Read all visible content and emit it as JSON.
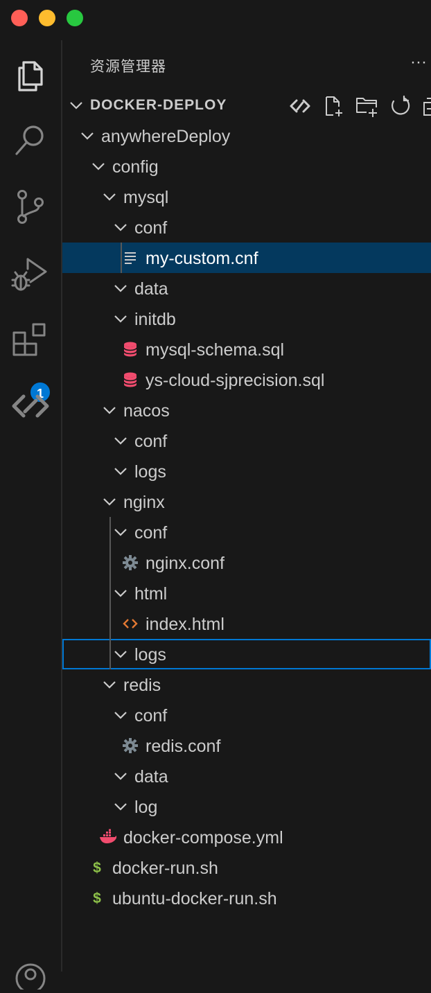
{
  "window": {
    "close_color": "#ff5f57",
    "minimize_color": "#febc2e",
    "maximize_color": "#28c840"
  },
  "activity_bar": {
    "items": [
      {
        "icon": "files-icon"
      },
      {
        "icon": "search-icon"
      },
      {
        "icon": "source-control-icon"
      },
      {
        "icon": "run-debug-icon"
      },
      {
        "icon": "extensions-icon",
        "badge": "1"
      },
      {
        "icon": "remote-icon"
      },
      {
        "icon": "account-icon"
      }
    ]
  },
  "explorer": {
    "title": "资源管理器",
    "more": "···",
    "root": "DOCKER-DEPLOY",
    "toolbar": [
      "remote-icon",
      "new-file-icon",
      "new-folder-icon",
      "refresh-icon",
      "collapse-all-icon"
    ]
  },
  "tree": [
    {
      "label": "anywhereDeploy",
      "type": "folder",
      "depth": 1
    },
    {
      "label": "config",
      "type": "folder",
      "depth": 2
    },
    {
      "label": "mysql",
      "type": "folder",
      "depth": 3
    },
    {
      "label": "conf",
      "type": "folder",
      "depth": 4
    },
    {
      "label": "my-custom.cnf",
      "type": "file",
      "icon": "text-file-icon",
      "depth": 5,
      "selected": true
    },
    {
      "label": "data",
      "type": "folder",
      "depth": 4
    },
    {
      "label": "initdb",
      "type": "folder",
      "depth": 4
    },
    {
      "label": "mysql-schema.sql",
      "type": "file",
      "icon": "database-icon",
      "depth": 5
    },
    {
      "label": "ys-cloud-sjprecision.sql",
      "type": "file",
      "icon": "database-icon",
      "depth": 5
    },
    {
      "label": "nacos",
      "type": "folder",
      "depth": 3
    },
    {
      "label": "conf",
      "type": "folder",
      "depth": 4
    },
    {
      "label": "logs",
      "type": "folder",
      "depth": 4
    },
    {
      "label": "nginx",
      "type": "folder",
      "depth": 3
    },
    {
      "label": "conf",
      "type": "folder",
      "depth": 4
    },
    {
      "label": "nginx.conf",
      "type": "file",
      "icon": "gear-icon",
      "depth": 5
    },
    {
      "label": "html",
      "type": "folder",
      "depth": 4
    },
    {
      "label": "index.html",
      "type": "file",
      "icon": "html-icon",
      "depth": 5
    },
    {
      "label": "logs",
      "type": "folder",
      "depth": 4,
      "focused": true
    },
    {
      "label": "redis",
      "type": "folder",
      "depth": 3
    },
    {
      "label": "conf",
      "type": "folder",
      "depth": 4
    },
    {
      "label": "redis.conf",
      "type": "file",
      "icon": "gear-icon",
      "depth": 5
    },
    {
      "label": "data",
      "type": "folder",
      "depth": 4
    },
    {
      "label": "log",
      "type": "folder",
      "depth": 4
    },
    {
      "label": "docker-compose.yml",
      "type": "file",
      "icon": "docker-icon",
      "depth": 3
    },
    {
      "label": "docker-run.sh",
      "type": "file",
      "icon": "shell-icon",
      "depth": 2
    },
    {
      "label": "ubuntu-docker-run.sh",
      "type": "file",
      "icon": "shell-icon",
      "depth": 2
    }
  ]
}
